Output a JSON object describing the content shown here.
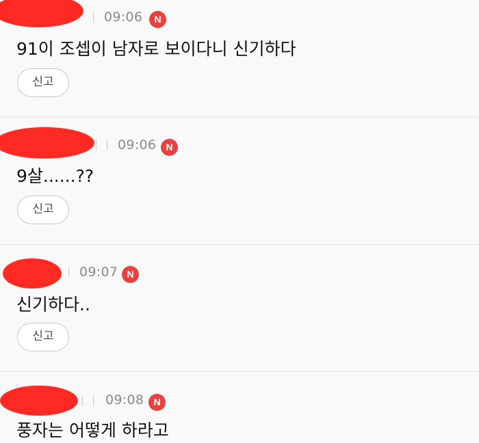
{
  "badge_label": "N",
  "report_label": "신고",
  "comments": [
    {
      "time": "09:06",
      "text": "91이 조셉이 남자로 보이다니 신기하다"
    },
    {
      "time": "09:06",
      "text": "9살......??"
    },
    {
      "time": "09:07",
      "text": "신기하다.."
    },
    {
      "time": "09:08",
      "text": "풍자는 어떻게 하라고"
    }
  ],
  "colors": {
    "redaction": "#ff2a24",
    "badge": "#e8413f",
    "background": "#f9f9f9"
  }
}
